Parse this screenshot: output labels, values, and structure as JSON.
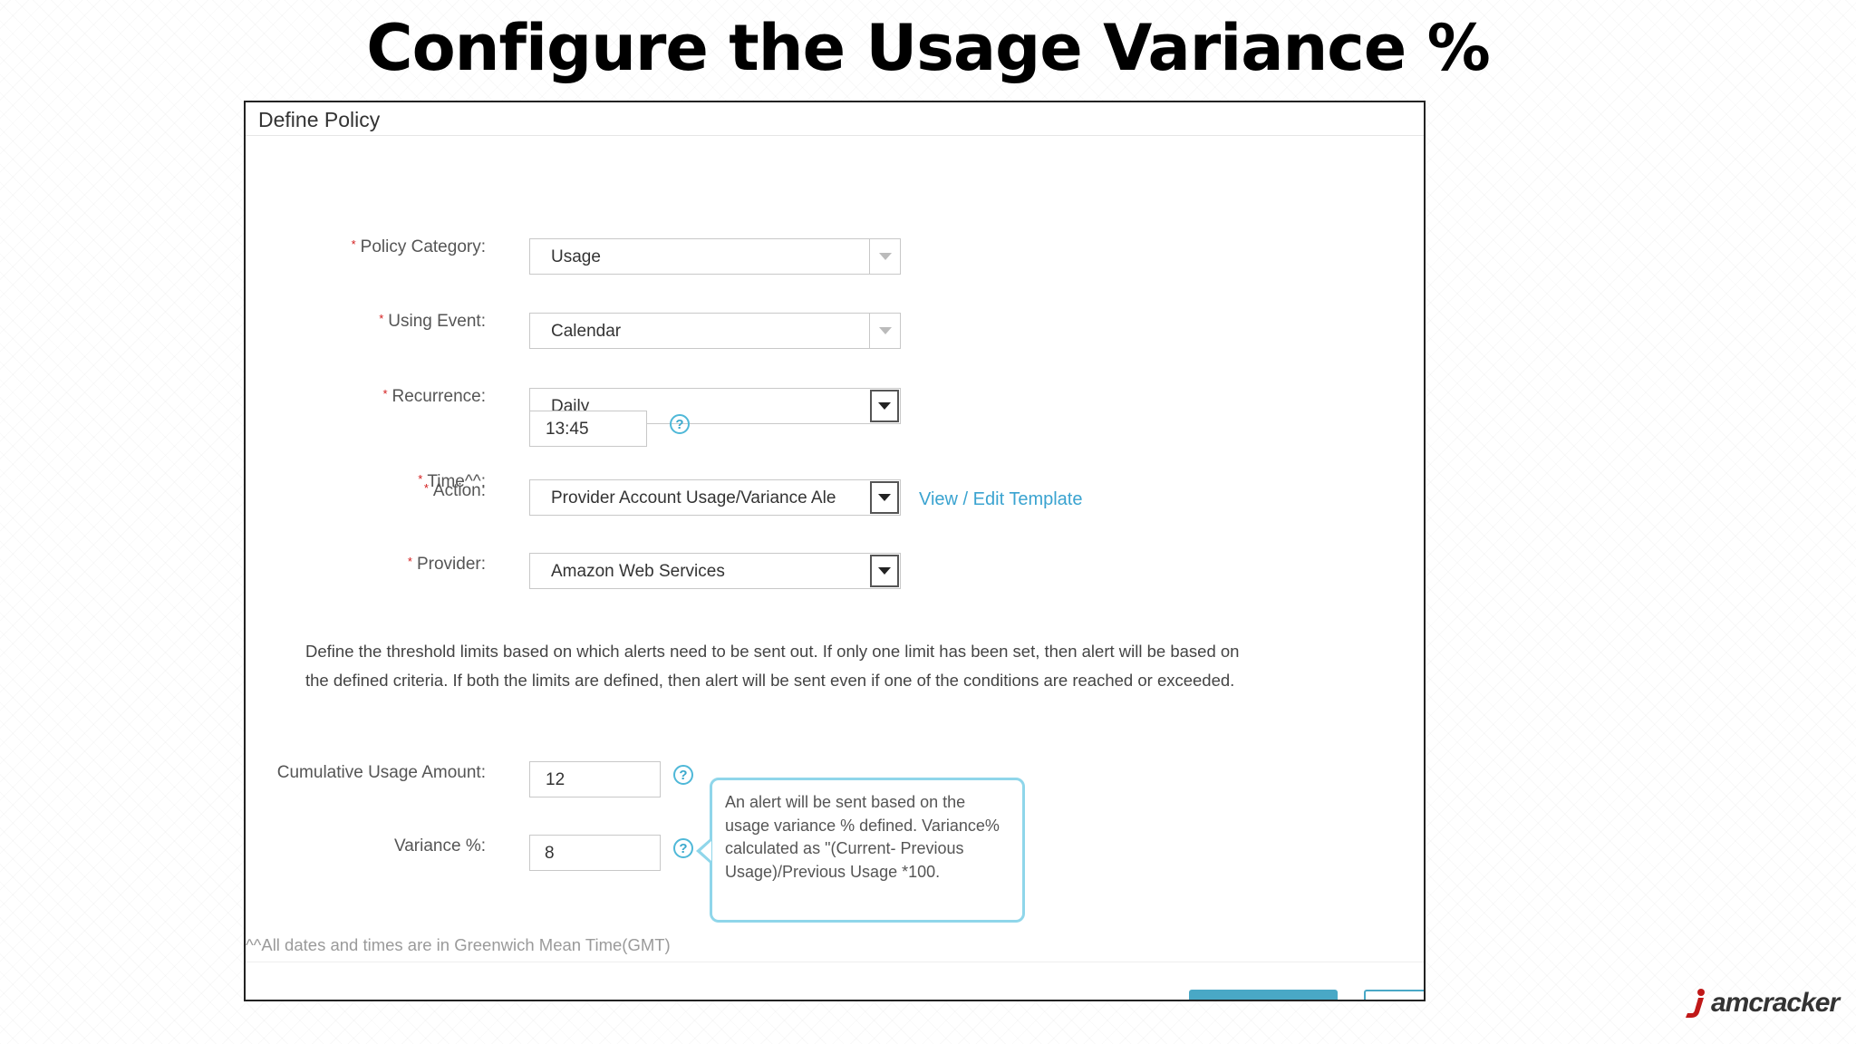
{
  "slide": {
    "title": "Configure the Usage Variance %"
  },
  "panel": {
    "title": "Define Policy"
  },
  "form": {
    "policy_category": {
      "label": "Policy Category:",
      "value": "Usage"
    },
    "using_event": {
      "label": "Using Event:",
      "value": "Calendar"
    },
    "recurrence": {
      "label": "Recurrence:",
      "value": "Daily"
    },
    "time": {
      "label": "Time^^:",
      "value": "13:45"
    },
    "action": {
      "label": "Action:",
      "value": "Provider Account Usage/Variance Ale",
      "link": "View / Edit Template"
    },
    "provider": {
      "label": "Provider:",
      "value": "Amazon Web Services"
    },
    "description": "Define the threshold limits based on which alerts need to be sent out.  If only one limit has been set, then alert will be based on the defined criteria. If both the limits are defined, then alert will be sent even if one of the conditions are reached or exceeded.",
    "cumulative_usage": {
      "label": "Cumulative Usage Amount:",
      "value": "12"
    },
    "variance": {
      "label": "Variance %:",
      "value": "8"
    },
    "tooltip": "An alert will be sent based on the usage variance % defined. Variance% calculated as \"(Current- Previous Usage)/Previous Usage *100.",
    "footnote": "^^All dates and times are in Greenwich Mean Time(GMT)",
    "required_marker": "*",
    "help_glyph": "?"
  },
  "brand": {
    "logo_text": "amcracker",
    "logo_letter": "j"
  },
  "colors": {
    "accent": "#3aa3d0",
    "tooltip_border": "#8fd6ea",
    "required": "#d31b1b",
    "button": "#49a8c6"
  }
}
